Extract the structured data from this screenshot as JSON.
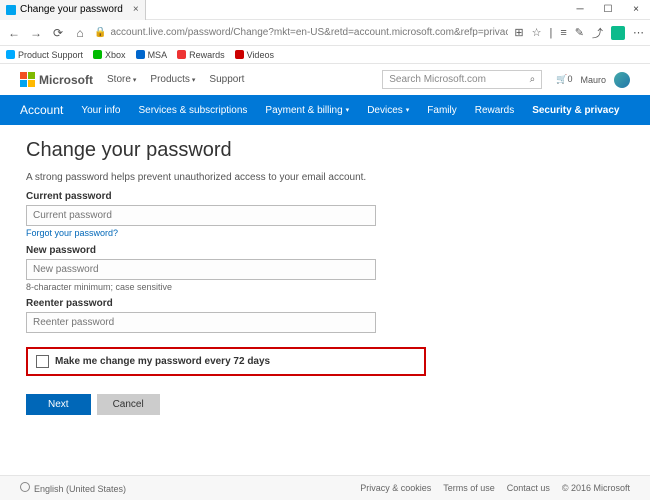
{
  "window": {
    "title": "Change your password"
  },
  "address": {
    "url": "account.live.com/password/Change?mkt=en-US&retd=account.microsoft.com&refp=privacy"
  },
  "favorites": [
    "Product Support",
    "Xbox",
    "MSA",
    "Rewards",
    "Videos"
  ],
  "header": {
    "brand": "Microsoft",
    "nav": {
      "store": "Store",
      "products": "Products",
      "support": "Support"
    },
    "search_placeholder": "Search Microsoft.com",
    "cart_count": "0",
    "user": "Mauro"
  },
  "tabs": {
    "account": "Account",
    "your_info": "Your info",
    "services": "Services & subscriptions",
    "payment": "Payment & billing",
    "devices": "Devices",
    "family": "Family",
    "rewards": "Rewards",
    "security": "Security & privacy"
  },
  "main": {
    "title": "Change your password",
    "desc": "A strong password helps prevent unauthorized access to your email account.",
    "current_label": "Current password",
    "current_placeholder": "Current password",
    "forgot": "Forgot your password?",
    "new_label": "New password",
    "new_placeholder": "New password",
    "hint": "8-character minimum; case sensitive",
    "reenter_label": "Reenter password",
    "reenter_placeholder": "Reenter password",
    "checkbox": "Make me change my password every 72 days",
    "next": "Next",
    "cancel": "Cancel"
  },
  "footer": {
    "lang": "English (United States)",
    "privacy": "Privacy & cookies",
    "terms": "Terms of use",
    "contact": "Contact us",
    "copyright": "© 2016 Microsoft"
  }
}
